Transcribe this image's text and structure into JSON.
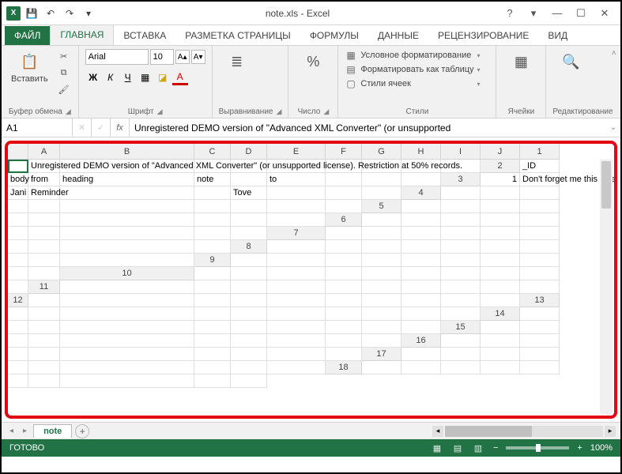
{
  "window": {
    "title": "note.xls - Excel",
    "help_icon": "?",
    "ribbon_opts_icon": "▾",
    "min_icon": "—",
    "max_icon": "☐",
    "close_icon": "✕"
  },
  "qat": {
    "excel_label": "X",
    "save_icon": "💾",
    "undo_icon": "↶",
    "redo_icon": "↷",
    "customize_icon": "▾"
  },
  "tabs": {
    "file": "ФАЙЛ",
    "home": "ГЛАВНАЯ",
    "insert": "ВСТАВКА",
    "page_layout": "РАЗМЕТКА СТРАНИЦЫ",
    "formulas": "ФОРМУЛЫ",
    "data": "ДАННЫЕ",
    "review": "РЕЦЕНЗИРОВАНИЕ",
    "view": "ВИД"
  },
  "ribbon": {
    "clipboard": {
      "label": "Буфер обмена",
      "paste": "Вставить",
      "paste_icon": "📋",
      "cut_icon": "✂",
      "copy_icon": "⧉",
      "painter_icon": "🖌"
    },
    "font": {
      "label": "Шрифт",
      "name": "Arial",
      "size": "10",
      "incr": "A▴",
      "decr": "A▾",
      "bold": "Ж",
      "italic": "К",
      "underline": "Ч",
      "border_icon": "▦",
      "fill_icon": "◪",
      "color_icon": "A"
    },
    "alignment": {
      "label": "Выравнивание",
      "icon": "≣"
    },
    "number": {
      "label": "Число",
      "icon": "%"
    },
    "styles": {
      "label": "Стили",
      "cond_fmt": "Условное форматирование",
      "as_table": "Форматировать как таблицу",
      "cell_styles": "Стили ячеек",
      "cond_icon": "▦",
      "table_icon": "▤",
      "cell_icon": "▢"
    },
    "cells": {
      "label": "Ячейки",
      "icon": "▦"
    },
    "editing": {
      "label": "Редактирование",
      "icon": "🔍"
    },
    "collapse_icon": "˄"
  },
  "formula_bar": {
    "name_box": "A1",
    "cancel_icon": "✕",
    "enter_icon": "✓",
    "fx": "fx",
    "value": "Unregistered DEMO version of \"Advanced XML Converter\" (or unsupported",
    "expand_icon": "⌄"
  },
  "sheet": {
    "columns": [
      "A",
      "B",
      "C",
      "D",
      "E",
      "F",
      "G",
      "H",
      "I",
      "J"
    ],
    "row_count": 18,
    "selected_ref": "A1",
    "row1_text": "Unregistered DEMO version of \"Advanced XML Converter\" (or unsupported license). Restriction at 50% records.",
    "row2": {
      "A": "_ID",
      "B": "body",
      "C": "from",
      "D": "heading",
      "E": "note",
      "G": "to"
    },
    "row3": {
      "A": "1",
      "B": "Don't forget me this weekend!",
      "C": "Jani",
      "D": "Reminder",
      "G": "Tove"
    }
  },
  "tabs_bar": {
    "sheet_name": "note",
    "add_icon": "+",
    "nav_left": "◂",
    "nav_right": "▸"
  },
  "statusbar": {
    "status": "ГОТОВО",
    "zoom": "100%",
    "minus": "−",
    "plus": "+"
  }
}
